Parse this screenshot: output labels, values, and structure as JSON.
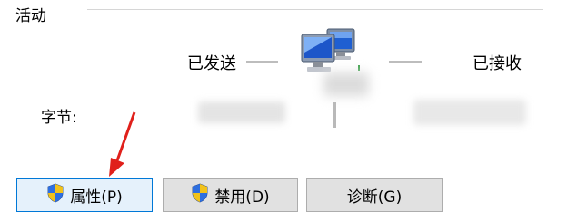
{
  "section": {
    "title": "活动"
  },
  "activity": {
    "sent_label": "已发送",
    "received_label": "已接收",
    "bytes_label": "字节:"
  },
  "icons": {
    "network": "network-computers-icon",
    "shield": "uac-shield-icon"
  },
  "buttons": {
    "properties": "属性(P)",
    "disable": "禁用(D)",
    "diagnose": "诊断(G)"
  },
  "colors": {
    "annotation_arrow": "#e0201b",
    "focus_border": "#0078d7",
    "button_bg": "#e1e1e1"
  }
}
